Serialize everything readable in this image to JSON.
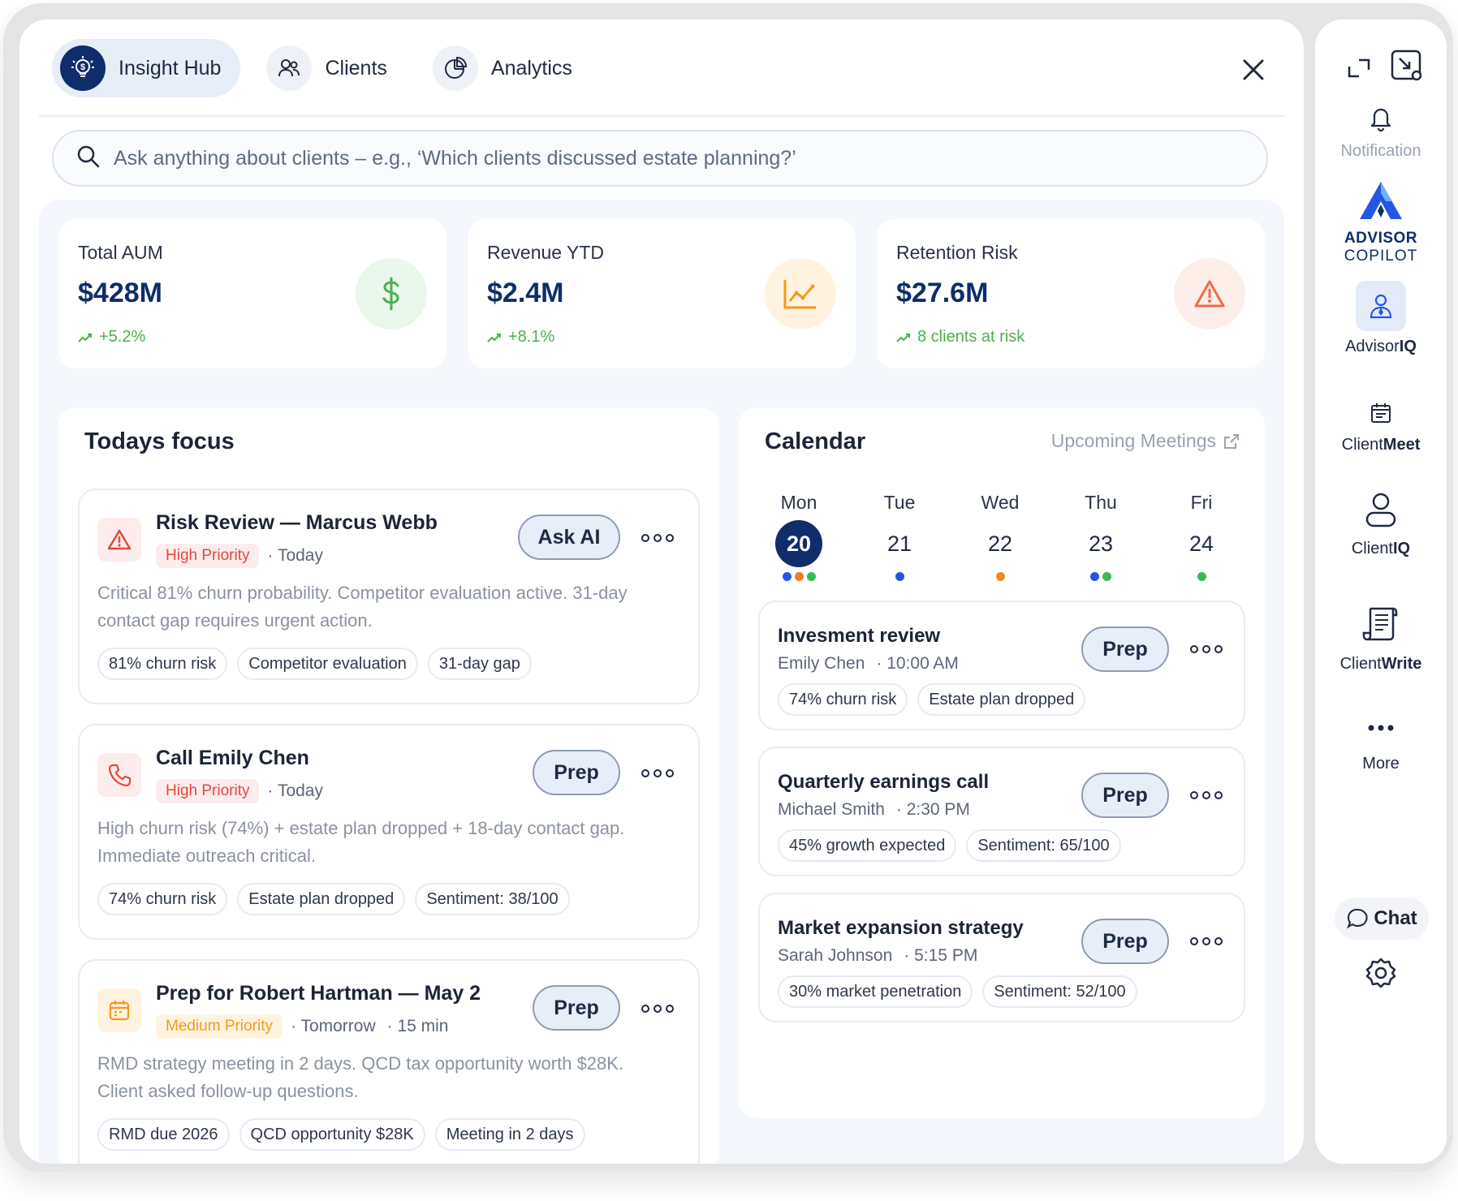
{
  "tabs": [
    {
      "label": "Insight Hub",
      "icon": "lightbulb-dollar-icon",
      "active": true
    },
    {
      "label": "Clients",
      "icon": "users-icon",
      "active": false
    },
    {
      "label": "Analytics",
      "icon": "pie-chart-icon",
      "active": false
    }
  ],
  "search": {
    "placeholder": "Ask anything about clients – e.g., ‘Which clients discussed estate planning?’"
  },
  "kpis": [
    {
      "label": "Total AUM",
      "value": "$428M",
      "delta": "+5.2%",
      "icon": "dollar-icon",
      "icon_bg": "#e9f7ec",
      "icon_color": "#4caf50"
    },
    {
      "label": "Revenue YTD",
      "value": "$2.4M",
      "delta": "+8.1%",
      "icon": "line-chart-icon",
      "icon_bg": "#fff3e0",
      "icon_color": "#f29a1a"
    },
    {
      "label": "Retention Risk",
      "value": "$27.6M",
      "delta": "8 clients at risk",
      "icon": "warning-icon",
      "icon_bg": "#fdeeea",
      "icon_color": "#ef6b4a"
    }
  ],
  "focus": {
    "title": "Todays focus",
    "items": [
      {
        "title": "Risk Review — Marcus Webb",
        "priority": "High Priority",
        "meta": [
          "Today"
        ],
        "action": "Ask AI",
        "desc": "Critical 81% churn probability. Competitor evaluation active. 31-day contact gap requires urgent action.",
        "tags": [
          "81% churn risk",
          "Competitor evaluation",
          "31-day gap"
        ],
        "icon": "alert-triangle-icon"
      },
      {
        "title": "Call Emily Chen",
        "priority": "High Priority",
        "meta": [
          "Today"
        ],
        "action": "Prep",
        "desc": "High churn risk (74%) + estate plan dropped + 18-day contact gap. Immediate outreach critical.",
        "tags": [
          "74% churn risk",
          "Estate plan dropped",
          "Sentiment: 38/100"
        ],
        "icon": "phone-icon"
      },
      {
        "title": "Prep for Robert Hartman — May 2",
        "priority": "Medium Priority",
        "meta": [
          "Tomorrow",
          "15 min"
        ],
        "action": "Prep",
        "desc": "RMD strategy meeting in 2 days. QCD tax opportunity worth $28K. Client asked follow-up questions.",
        "tags": [
          "RMD due 2026",
          "QCD opportunity $28K",
          "Meeting in 2 days"
        ],
        "icon": "calendar-icon"
      }
    ]
  },
  "calendar": {
    "title": "Calendar",
    "link": "Upcoming Meetings",
    "days": [
      {
        "name": "Mon",
        "num": "20",
        "today": true,
        "dots": [
          "#2456e6",
          "#f07a2a",
          "#3cb65a"
        ]
      },
      {
        "name": "Tue",
        "num": "21",
        "today": false,
        "dots": [
          "#2456e6"
        ]
      },
      {
        "name": "Wed",
        "num": "22",
        "today": false,
        "dots": [
          "#f28a1e"
        ]
      },
      {
        "name": "Thu",
        "num": "23",
        "today": false,
        "dots": [
          "#2456e6",
          "#3cb65a"
        ]
      },
      {
        "name": "Fri",
        "num": "24",
        "today": false,
        "dots": [
          "#3cb65a"
        ]
      }
    ],
    "meetings": [
      {
        "title": "Invesment review",
        "client": "Emily Chen",
        "time": "10:00 AM",
        "action": "Prep",
        "tags": [
          "74% churn risk",
          "Estate plan dropped"
        ]
      },
      {
        "title": "Quarterly earnings call",
        "client": "Michael Smith",
        "time": "2:30 PM",
        "action": "Prep",
        "tags": [
          "45% growth expected",
          "Sentiment: 65/100"
        ]
      },
      {
        "title": "Market expansion strategy",
        "client": "Sarah Johnson",
        "time": "5:15 PM",
        "action": "Prep",
        "tags": [
          "30% market penetration",
          "Sentiment: 52/100"
        ]
      }
    ]
  },
  "rail": {
    "notification": "Notification",
    "brand_line1": "ADVISOR",
    "brand_line2": "COPILOT",
    "items": [
      {
        "pre": "Advisor",
        "bold": "IQ",
        "icon": "advisor-icon"
      },
      {
        "pre": "Client",
        "bold": "Meet",
        "icon": "calendar-list-icon"
      },
      {
        "pre": "Client",
        "bold": "IQ",
        "icon": "person-icon"
      },
      {
        "pre": "Client",
        "bold": "Write",
        "icon": "document-icon"
      }
    ],
    "more": "More",
    "chat": "Chat"
  },
  "colors": {
    "brand": "#0f2d6b",
    "accent_blue": "#2456e6",
    "positive": "#4caf50",
    "danger": "#e2483d",
    "warning": "#f29a1a"
  }
}
